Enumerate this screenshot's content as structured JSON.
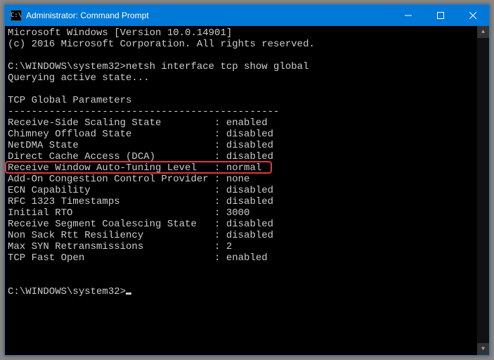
{
  "window": {
    "title": "Administrator: Command Prompt"
  },
  "header": {
    "line1": "Microsoft Windows [Version 10.0.14901]",
    "line2": "(c) 2016 Microsoft Corporation. All rights reserved."
  },
  "prompt1": {
    "path": "C:\\WINDOWS\\system32>",
    "command": "netsh interface tcp show global"
  },
  "querying": "Querying active state...",
  "section_title": "TCP Global Parameters",
  "divider": "----------------------------------------------",
  "params": [
    {
      "label": "Receive-Side Scaling State",
      "value": "enabled"
    },
    {
      "label": "Chimney Offload State",
      "value": "disabled"
    },
    {
      "label": "NetDMA State",
      "value": "disabled"
    },
    {
      "label": "Direct Cache Access (DCA)",
      "value": "disabled"
    },
    {
      "label": "Receive Window Auto-Tuning Level",
      "value": "normal"
    },
    {
      "label": "Add-On Congestion Control Provider",
      "value": "none"
    },
    {
      "label": "ECN Capability",
      "value": "disabled"
    },
    {
      "label": "RFC 1323 Timestamps",
      "value": "disabled"
    },
    {
      "label": "Initial RTO",
      "value": "3000"
    },
    {
      "label": "Receive Segment Coalescing State",
      "value": "disabled"
    },
    {
      "label": "Non Sack Rtt Resiliency",
      "value": "disabled"
    },
    {
      "label": "Max SYN Retransmissions",
      "value": "2"
    },
    {
      "label": "TCP Fast Open",
      "value": "enabled"
    }
  ],
  "highlighted_index": 4,
  "prompt2": {
    "path": "C:\\WINDOWS\\system32>"
  }
}
